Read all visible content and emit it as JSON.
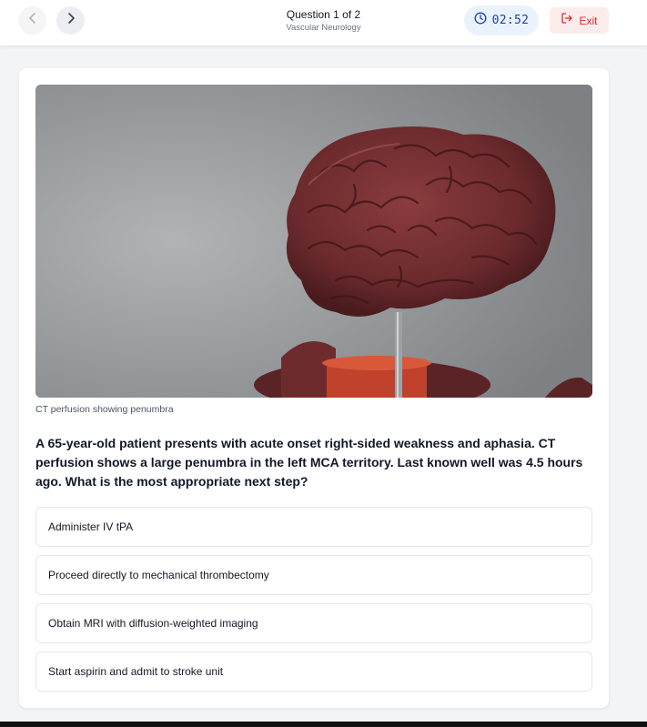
{
  "header": {
    "question_counter": "Question 1 of 2",
    "category": "Vascular Neurology",
    "timer": "02:52",
    "exit_label": "Exit"
  },
  "icons": {
    "prev": "chevron-left-icon",
    "next": "chevron-right-icon",
    "timer": "clock-icon",
    "exit": "sign-out-icon"
  },
  "colors": {
    "timer_bg": "#eaf2fd",
    "timer_text": "#1e40af",
    "exit_bg": "#fdecec",
    "exit_text": "#dc2626"
  },
  "question": {
    "caption": "CT perfusion showing penumbra",
    "text": "A 65-year-old patient presents with acute onset right-sided weakness and aphasia. CT perfusion shows a large penumbra in the left MCA territory. Last known well was 4.5 hours ago. What is the most appropriate next step?",
    "options": [
      "Administer IV tPA",
      "Proceed directly to mechanical thrombectomy",
      "Obtain MRI with diffusion-weighted imaging",
      "Start aspirin and admit to stroke unit"
    ]
  }
}
